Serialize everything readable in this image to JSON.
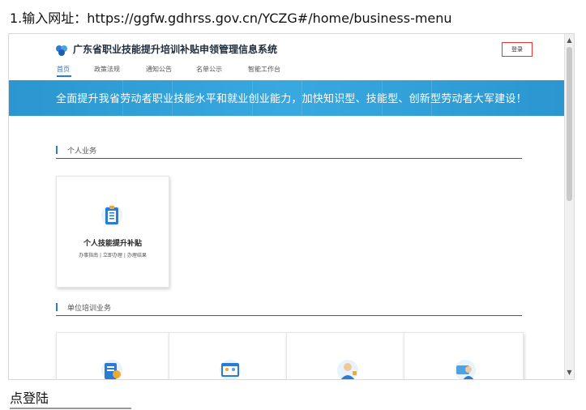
{
  "instructions": {
    "top": "1.输入网址：https://ggfw.gdhrss.gov.cn/YCZG#/home/business-menu",
    "bottom": "点登陆"
  },
  "site": {
    "title": "广东省职业技能提升培训补贴申领管理信息系统",
    "login_label": "登录",
    "nav": [
      "首页",
      "政策法规",
      "通知公告",
      "名单公示",
      "智能工作台"
    ],
    "active_nav": "首页"
  },
  "banner": {
    "text": "全面提升我省劳动者职业技能水平和就业创业能力，加快知识型、技能型、创新型劳动者大军建设！"
  },
  "sections": [
    {
      "label": "个人业务",
      "cards": [
        {
          "title": "个人技能提升补贴",
          "links": [
            "办事指南",
            "立即办理",
            "办理结果"
          ],
          "icon": "clipboard-icon"
        }
      ]
    },
    {
      "label": "单位培训业务",
      "cards": [
        {
          "icon": "document-stamp-icon"
        },
        {
          "icon": "browser-users-icon"
        },
        {
          "icon": "person-like-icon"
        },
        {
          "icon": "idcard-person-icon"
        }
      ]
    }
  ],
  "colors": {
    "brand_blue": "#2a7bd4",
    "banner_blue": "#2b96d0",
    "login_border": "#e33"
  }
}
